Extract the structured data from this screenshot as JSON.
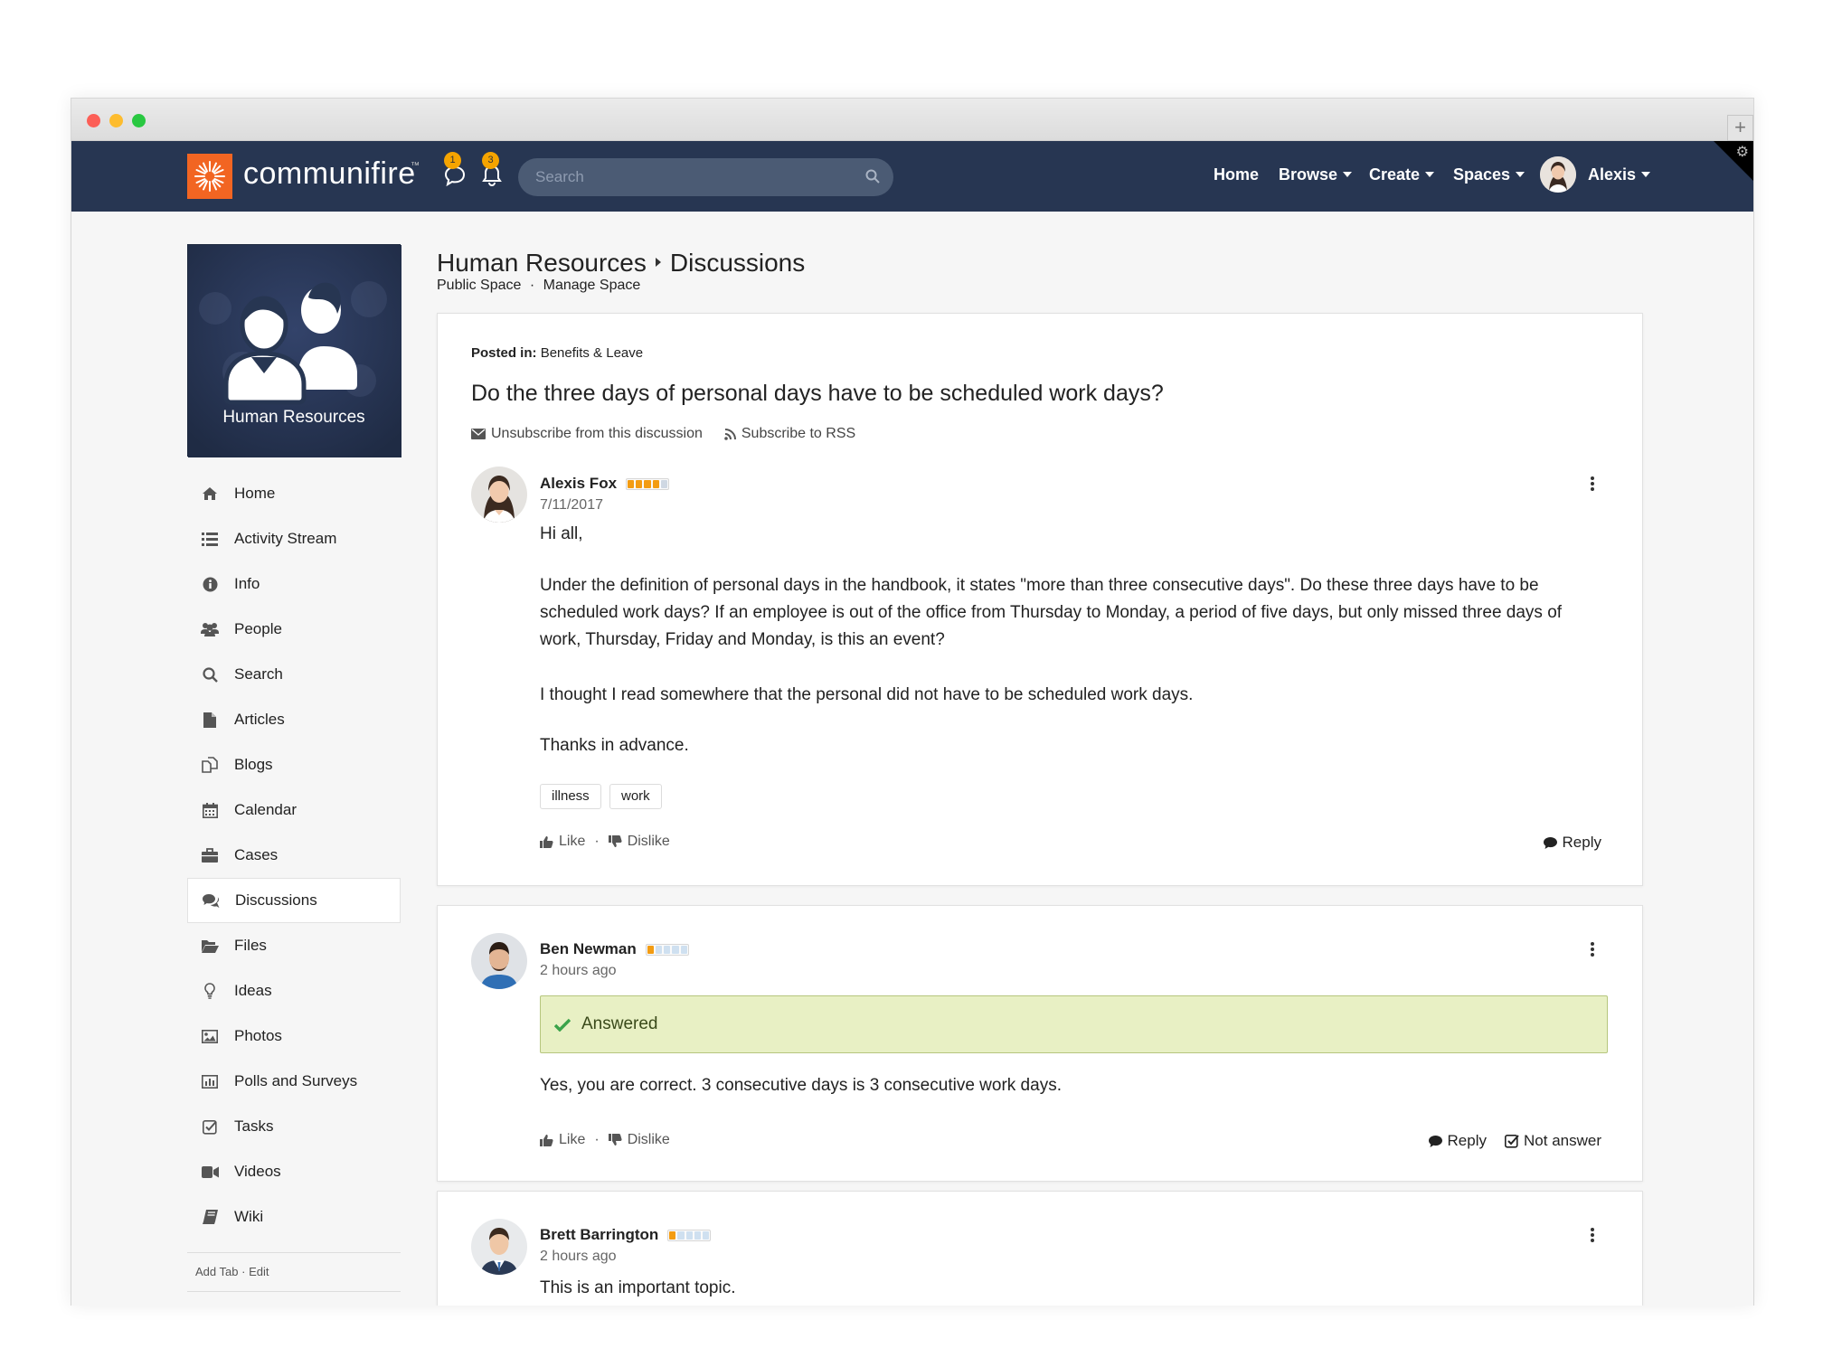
{
  "brand": {
    "name": "communifire",
    "tm": "™"
  },
  "header": {
    "messages_badge": "1",
    "notifications_badge": "3",
    "search_placeholder": "Search",
    "nav": {
      "home": "Home",
      "browse": "Browse",
      "create": "Create",
      "spaces": "Spaces",
      "user": "Alexis"
    }
  },
  "space": {
    "name": "Human Resources"
  },
  "sidebar": {
    "items": [
      {
        "label": "Home",
        "icon": "home-icon"
      },
      {
        "label": "Activity Stream",
        "icon": "list-icon"
      },
      {
        "label": "Info",
        "icon": "info-icon"
      },
      {
        "label": "People",
        "icon": "people-icon"
      },
      {
        "label": "Search",
        "icon": "search-icon"
      },
      {
        "label": "Articles",
        "icon": "file-icon"
      },
      {
        "label": "Blogs",
        "icon": "copy-icon"
      },
      {
        "label": "Calendar",
        "icon": "calendar-icon"
      },
      {
        "label": "Cases",
        "icon": "briefcase-icon"
      },
      {
        "label": "Discussions",
        "icon": "comments-icon"
      },
      {
        "label": "Files",
        "icon": "folder-open-icon"
      },
      {
        "label": "Ideas",
        "icon": "lightbulb-icon"
      },
      {
        "label": "Photos",
        "icon": "image-icon"
      },
      {
        "label": "Polls and Surveys",
        "icon": "bar-chart-icon"
      },
      {
        "label": "Tasks",
        "icon": "checkbox-icon"
      },
      {
        "label": "Videos",
        "icon": "video-camera-icon"
      },
      {
        "label": "Wiki",
        "icon": "book-icon"
      }
    ],
    "active": "Discussions",
    "footer": {
      "add_tab": "Add Tab",
      "separator": "·",
      "edit": "Edit"
    }
  },
  "page": {
    "breadcrumb_space": "Human Resources",
    "breadcrumb_section": "Discussions",
    "public_space": "Public Space",
    "dot": "·",
    "manage_space": "Manage Space"
  },
  "discussion": {
    "posted_in_label": "Posted in:",
    "posted_in_value": "Benefits & Leave",
    "title": "Do the three days of personal days have to be scheduled work days?",
    "unsubscribe": "Unsubscribe from this discussion",
    "subscribe_rss": "Subscribe to RSS",
    "author": "Alexis Fox",
    "date": "7/11/2017",
    "paragraphs": [
      "Hi all,",
      "Under the definition of personal days in the handbook, it states \"more than three consecutive days\". Do these three days have to be scheduled work days? If an employee is out of the office from Thursday to Monday, a period of five days, but only missed three days of work, Thursday, Friday and Monday, is this an event?",
      "I thought I read somewhere that the personal did not have to be scheduled work days.",
      "Thanks in advance."
    ],
    "tags": [
      "illness",
      "work"
    ],
    "like": "Like",
    "dislike": "Dislike",
    "reply": "Reply"
  },
  "replies": [
    {
      "author": "Ben Newman",
      "date": "2 hours ago",
      "answered_label": "Answered",
      "text": "Yes, you are correct. 3 consecutive days is 3 consecutive work days.",
      "like": "Like",
      "dislike": "Dislike",
      "reply": "Reply",
      "not_answer": "Not answer"
    },
    {
      "author": "Brett Barrington",
      "date": "2 hours ago",
      "text": "This is an important topic."
    }
  ],
  "colors": {
    "nav_bg": "#273652",
    "brand_orange": "#f26522",
    "badge": "#f5a400",
    "answered_bg": "#e8f0c4",
    "answered_check": "#3aa34a"
  }
}
